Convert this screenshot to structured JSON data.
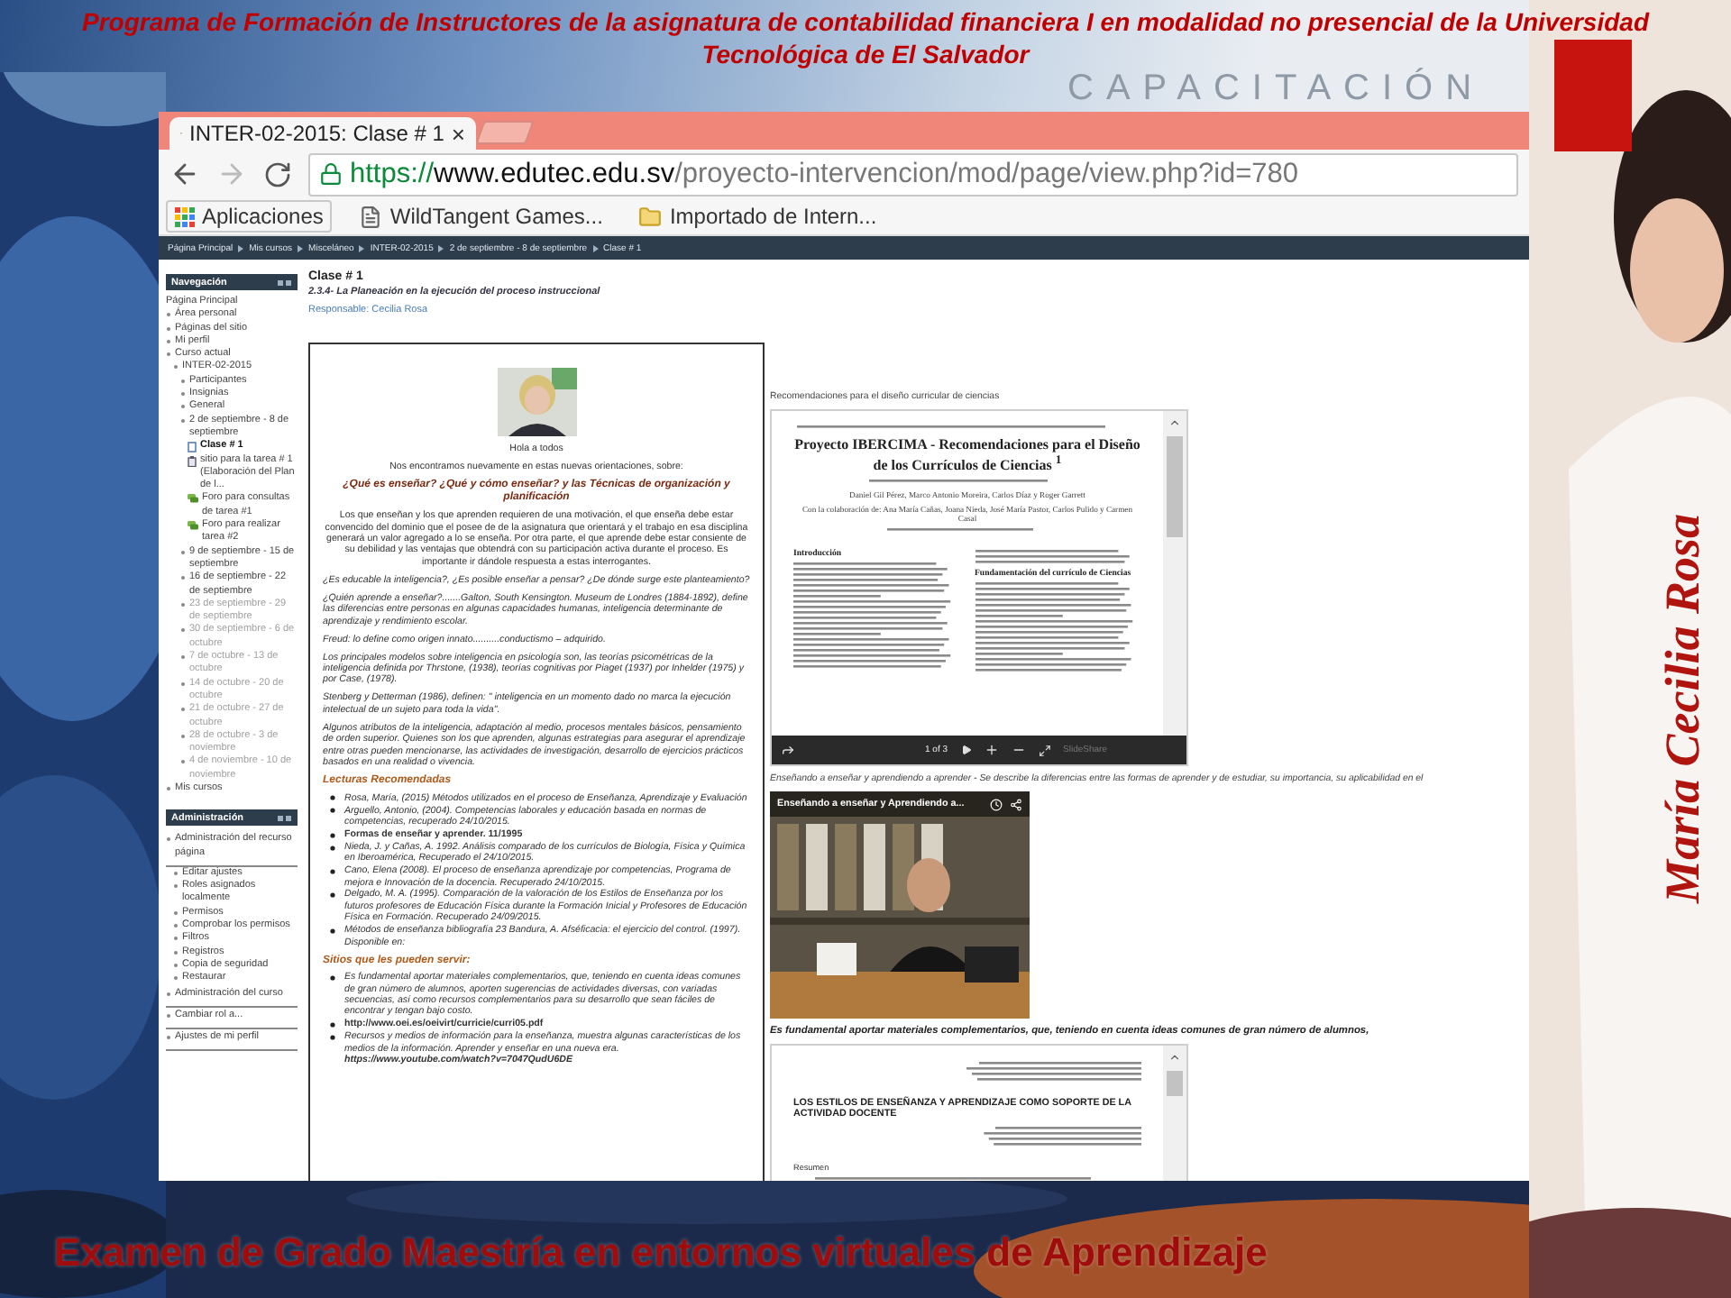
{
  "slide": {
    "title": "Programa de Formación de Instructores de la  asignatura de contabilidad financiera I   en modalidad no presencial  de    la Universidad Tecnológica de El Salvador",
    "banner_word": "CAPACITACIÓN",
    "signature": "María Cecilia Rosa",
    "footer": "Examen de Grado Maestría en entornos virtuales de Aprendizaje"
  },
  "browser": {
    "tab": {
      "title": "INTER-02-2015: Clase # 1",
      "close": "×"
    },
    "url": {
      "scheme": "https://",
      "host": "www.edutec.edu.sv",
      "path": "/proyecto-intervencion/mod/page/view.php?id=780"
    },
    "bookmarks": [
      {
        "kind": "apps",
        "label": "Aplicaciones"
      },
      {
        "kind": "page",
        "label": "WildTangent Games..."
      },
      {
        "kind": "folder",
        "label": "Importado de Intern..."
      }
    ]
  },
  "breadcrumb": [
    "Página Principal",
    "Mis cursos",
    "Misceláneo",
    "INTER-02-2015",
    "2 de septiembre - 8 de septiembre",
    "Clase # 1"
  ],
  "navigation": {
    "title": "Navegación",
    "items": [
      {
        "label": "Página Principal",
        "kind": "text",
        "selected": false,
        "dimmed": false
      },
      {
        "label": "Área personal",
        "kind": "link",
        "selected": false,
        "dimmed": false
      },
      {
        "label": "Páginas del sitio",
        "kind": "link",
        "selected": false,
        "dimmed": false
      },
      {
        "label": "Mi perfil",
        "kind": "link",
        "selected": false,
        "dimmed": false
      },
      {
        "label": "Curso actual",
        "kind": "link",
        "selected": false,
        "dimmed": false,
        "children": [
          {
            "label": "INTER-02-2015",
            "kind": "link",
            "selected": false,
            "dimmed": false,
            "children": [
              {
                "label": "Participantes",
                "kind": "link",
                "selected": false,
                "dimmed": false
              },
              {
                "label": "Insignias",
                "kind": "link",
                "selected": false,
                "dimmed": false
              },
              {
                "label": "General",
                "kind": "link",
                "selected": false,
                "dimmed": false
              },
              {
                "label": "2 de septiembre - 8 de septiembre",
                "kind": "link",
                "selected": false,
                "dimmed": false,
                "children": [
                  {
                    "label": "Clase # 1",
                    "kind": "page",
                    "selected": true,
                    "dimmed": false
                  },
                  {
                    "label": "sitio para la tarea # 1 (Elaboración del Plan de l...",
                    "kind": "assignment",
                    "selected": false,
                    "dimmed": false
                  },
                  {
                    "label": "Foro para consultas de tarea #1",
                    "kind": "forum",
                    "selected": false,
                    "dimmed": false
                  },
                  {
                    "label": "Foro para realizar tarea #2",
                    "kind": "forum",
                    "selected": false,
                    "dimmed": false
                  }
                ]
              },
              {
                "label": "9 de septiembre - 15 de septiembre",
                "kind": "link",
                "selected": false,
                "dimmed": false
              },
              {
                "label": "16 de septiembre - 22 de septiembre",
                "kind": "link",
                "selected": false,
                "dimmed": false
              },
              {
                "label": "23 de septiembre - 29 de septiembre",
                "kind": "link",
                "selected": false,
                "dimmed": true
              },
              {
                "label": "30 de septiembre - 6 de octubre",
                "kind": "link",
                "selected": false,
                "dimmed": true
              },
              {
                "label": "7 de octubre - 13 de octubre",
                "kind": "link",
                "selected": false,
                "dimmed": true
              },
              {
                "label": "14 de octubre - 20 de octubre",
                "kind": "link",
                "selected": false,
                "dimmed": true
              },
              {
                "label": "21 de octubre - 27 de octubre",
                "kind": "link",
                "selected": false,
                "dimmed": true
              },
              {
                "label": "28 de octubre - 3 de noviembre",
                "kind": "link",
                "selected": false,
                "dimmed": true
              },
              {
                "label": "4 de noviembre - 10 de noviembre",
                "kind": "link",
                "selected": false,
                "dimmed": true
              }
            ]
          }
        ]
      },
      {
        "label": "Mis cursos",
        "kind": "link",
        "selected": false,
        "dimmed": false
      }
    ]
  },
  "administration": {
    "title": "Administración",
    "items": [
      {
        "label": "Administración del recurso página",
        "kind": "link",
        "selected": false,
        "dimmed": false,
        "children": [
          {
            "label": "Editar ajustes",
            "kind": "link",
            "selected": false,
            "dimmed": false
          },
          {
            "label": "Roles asignados localmente",
            "kind": "link",
            "selected": false,
            "dimmed": false
          },
          {
            "label": "Permisos",
            "kind": "link",
            "selected": false,
            "dimmed": false
          },
          {
            "label": "Comprobar los permisos",
            "kind": "link",
            "selected": false,
            "dimmed": false
          },
          {
            "label": "Filtros",
            "kind": "link",
            "selected": false,
            "dimmed": false
          },
          {
            "label": "Registros",
            "kind": "link",
            "selected": false,
            "dimmed": false
          },
          {
            "label": "Copia de seguridad",
            "kind": "link",
            "selected": false,
            "dimmed": false
          },
          {
            "label": "Restaurar",
            "kind": "link",
            "selected": false,
            "dimmed": false
          }
        ]
      },
      {
        "label": "Administración del curso",
        "kind": "link",
        "selected": false,
        "dimmed": false
      },
      {
        "label": "Cambiar rol a...",
        "kind": "link",
        "selected": false,
        "dimmed": false
      },
      {
        "label": "Ajustes de mi perfil",
        "kind": "link",
        "selected": false,
        "dimmed": false
      }
    ]
  },
  "page": {
    "title": "Clase # 1",
    "subtitle": "2.3.4- La Planeación en  la ejecución del proceso instruccional",
    "responsible": "Responsable: Cecilia Rosa",
    "article": [
      {
        "kind": "picture"
      },
      {
        "kind": "center",
        "text": "Hola a todos"
      },
      {
        "kind": "center",
        "text": "Nos encontramos nuevamente en estas nuevas orientaciones, sobre:"
      },
      {
        "kind": "heading",
        "text": "¿Qué es enseñar? ¿Qué y cómo enseñar?  y las Técnicas de organización y planificación"
      },
      {
        "kind": "center",
        "text": "Los que enseñan y los que aprenden requieren de una motivación, el que enseña debe estar  convencido del dominio que el posee de  de la asignatura   que orientará y el trabajo en esa disciplina generará un valor  agregado a lo se enseña. Por otra parte,  el  que aprende  debe estar consiente de su debilidad  y las ventajas que  obtendrá con su participación activa  durante el  proceso.  Es importante ir dándole respuesta a estas interrogantes."
      },
      {
        "kind": "paragraph",
        "text": "¿Es educable la inteligencia?, ¿Es posible enseñar a pensar? ¿De dónde surge este planteamiento?"
      },
      {
        "kind": "paragraph",
        "text": "¿Quién aprende a  enseñar?.......Galton, South Kensington. Museum de Londres (1884-1892), define las diferencias entre personas en algunas capacidades humanas, inteligencia determinante de aprendizaje y rendimiento escolar."
      },
      {
        "kind": "paragraph",
        "text": "Freud: lo define como origen innato..........conductismo – adquirido."
      },
      {
        "kind": "paragraph",
        "text": "Los principales modelos sobre inteligencia en psicología son,  las  teorías psicométricas de la inteligencia definida  por  Thrstone, (1938), teorías cognitivas  por Piaget (1937) por Inhelder (1975) y por  Case, (1978)."
      },
      {
        "kind": "paragraph",
        "text": "Stenberg y Detterman (1986), definen: \" inteligencia  en un momento  dado  no marca la ejecución  intelectual de un sujeto para toda  la vida\"."
      },
      {
        "kind": "paragraph",
        "text": "Algunos atributos de la  inteligencia, adaptación al medio, procesos mentales básicos, pensamiento de orden superior.   Quienes son los que aprenden,   algunas  estrategias para asegurar el aprendizaje entre otras pueden mencionarse, las actividades  de investigación, desarrollo de  ejercicios prácticos basados en una realidad  o vivencia."
      },
      {
        "kind": "section",
        "text": "Lecturas Recomendadas"
      },
      {
        "kind": "bullets",
        "items": [
          {
            "text": "Rosa, María, (2015) Métodos utilizados en el proceso de Enseñanza, Aprendizaje y Evaluación",
            "bold": false
          },
          {
            "text": "Arguello, Antonio, (2004). Competencias laborales y educación basada en normas de competencias, recuperado 24/10/2015.",
            "bold": false
          },
          {
            "text": "Formas de enseñar y aprender. 11/1995",
            "bold": true
          },
          {
            "text": "Nieda, J. y Cañas, A. 1992. Análisis comparado de los currículos de Biología, Física y Química en Iberoamérica, Recuperado  el 24/10/2015.",
            "bold": false
          },
          {
            "text": "Cano, Elena (2008). El proceso de enseñanza aprendizaje por competencias, Programa de mejora e Innovación de la docencia. Recuperado  24/10/2015.",
            "bold": false
          },
          {
            "text": "Delgado, M. A. (1995). Comparación de la valoración de los Estilos de Enseñanza por los futuros profesores de Educación Física durante la Formación Inicial y Profesores de Educación Física en Formación. Recuperado 24/09/2015.",
            "bold": false
          },
          {
            "text": "Métodos de enseñanza bibliografía 23 Bandura, A.  Afséficacia:  el ejercicio del control. (1997). Disponible en:",
            "bold": false
          }
        ]
      },
      {
        "kind": "section",
        "text": "Sitios que les pueden servir:"
      },
      {
        "kind": "bullets",
        "items": [
          {
            "text": "Es fundamental  aportar materiales complementarios, que, teniendo en  cuenta ideas comunes de gran número de alumnos, aporten sugerencias de actividades diversas, con variadas secuencias, así como recursos complementarios para su desarrollo que sean fáciles de encontrar y tengan bajo costo.",
            "bold": false
          },
          {
            "text": "http://www.oei.es/oeivirt/curricie/curri05.pdf",
            "bold": true
          },
          {
            "text": "Recursos y medios de información para la enseñanza, muestra algunas características de  los medios de la información. Aprender y enseñar en una nueva era.",
            "link": "https://www.youtube.com/watch?v=7047QudU6DE",
            "bold": false
          }
        ]
      }
    ],
    "embeds": [
      {
        "kind": "caption",
        "text": "Recomendaciones para el diseño curricular de ciencias"
      },
      {
        "kind": "slideshow",
        "title": "Proyecto IBERCIMA - Recomendaciones para el Diseño de los Currículos de Ciencias $^{1}$",
        "authors": "Daniel Gil Pérez, Marco Antonio Moreira, Carlos Díaz y Roger Garrett",
        "collaborators": "Con la colaboración de: Ana María Cañas, Joana Nieda, José María Pastor, Carlos Pulido y Carmen Casal",
        "left_heading": "Introducción",
        "right_heading": "Fundamentación del currículo de Ciencias",
        "page": "1 of 3",
        "brand": "SlideShare"
      },
      {
        "kind": "italic_caption",
        "text": "Enseñando a enseñar y aprendiendo a aprender - Se describe la diferencias  entre las formas de aprender y de estudiar,  su  importancia,  su aplicabilidad  en el"
      },
      {
        "kind": "video",
        "title": "Enseñando a enseñar y Aprendiendo a..."
      },
      {
        "kind": "bold_caption",
        "text": "Es fundamental  aportar materiales complementarios, que, teniendo en  cuenta ideas comunes de gran número de alumnos,"
      },
      {
        "kind": "document",
        "title": "LOS ESTILOS DE ENSEÑANZA Y APRENDIZAJE COMO SOPORTE DE LA ACTIVIDAD DOCENTE",
        "section": "Resumen"
      }
    ]
  }
}
